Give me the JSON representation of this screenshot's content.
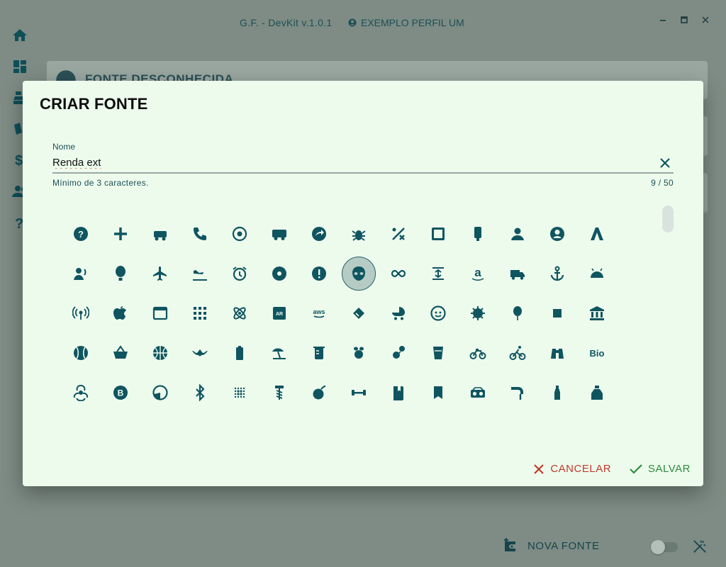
{
  "app": {
    "title": "G.F. - DevKit v.1.0.1",
    "profile": "EXEMPLO PERFIL UM",
    "background_card_title": "FONTE DESCONHECIDA",
    "new_button": "NOVA FONTE"
  },
  "dialog": {
    "title": "CRIAR FONTE",
    "field_label": "Nome",
    "field_value": "Renda ext",
    "hint": "Mínimo de 3 caracteres.",
    "counter": "9 / 50",
    "cancel": "CANCELAR",
    "save": "SALVAR"
  },
  "icons": [
    "help-circle",
    "plus",
    "golf-cart",
    "phone-forward",
    "network",
    "rv-truck",
    "share-circle",
    "bug",
    "route-strike",
    "wordpress-alert",
    "usb-drive",
    "account",
    "account-circle",
    "adobe",
    "account-tie-voice",
    "hot-air-balloon",
    "airplane",
    "airplane-landing",
    "alarm",
    "album",
    "alert-circle",
    "alien",
    "infinity",
    "align-vertical-center",
    "amazon",
    "ambulance",
    "anchor",
    "android",
    "antenna",
    "apple",
    "application",
    "apps",
    "atom",
    "augmented-reality",
    "aws",
    "bandage-tag",
    "baby-carriage",
    "baby-face",
    "bacteria",
    "balloon",
    "bandage",
    "bank",
    "baseball",
    "basket",
    "basketball",
    "bat",
    "battery",
    "beach",
    "beaker",
    "bee",
    "bee-flower",
    "beer-glass",
    "bicycle",
    "cyclist",
    "binoculars",
    "bio",
    "biohazard",
    "bitcoin",
    "blender",
    "bluetooth",
    "blur",
    "bolt",
    "bomb",
    "dumbbell",
    "book",
    "bookmark",
    "boombox",
    "bottle-opener",
    "bottle-wine",
    "bottle-tonic"
  ],
  "selected_icon_index": 21,
  "colors": {
    "accent": "#0f5560",
    "dialog_bg": "#edfbed",
    "cancel": "#c0392b",
    "save": "#2e8b3d"
  }
}
